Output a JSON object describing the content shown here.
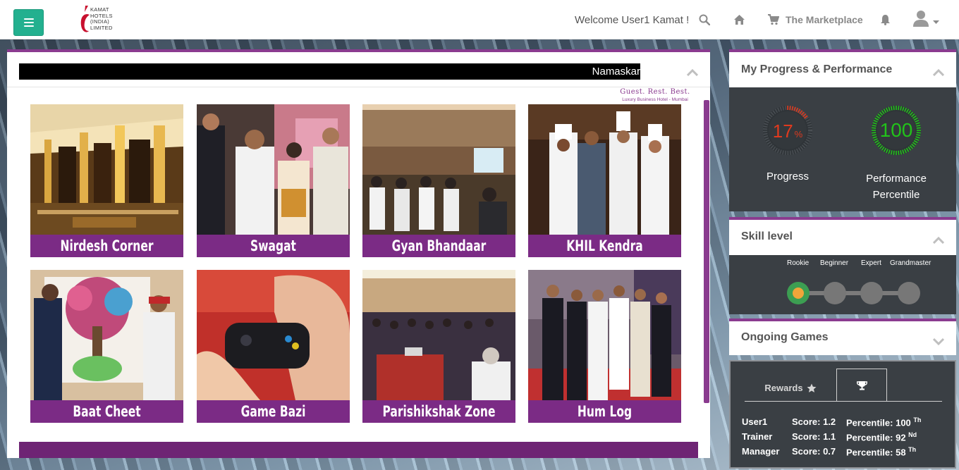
{
  "header": {
    "logo": {
      "line1": "KAMAT",
      "line2": "HOTELS",
      "line3": "(INDIA)",
      "line4": "LIMITED"
    },
    "welcome": "Welcome User1 Kamat !",
    "marketplace_label": "The Marketplace",
    "icons": [
      "menu-icon",
      "search-icon",
      "home-icon",
      "cart-icon",
      "bell-icon",
      "user-icon",
      "caret-down-icon"
    ]
  },
  "main": {
    "marquee": "Namaskar",
    "tagline": "Guest. Rest. Best.",
    "subtagline": "Luxury Business Hotel - Mumbai",
    "tiles": [
      {
        "label": "Nirdesh Corner"
      },
      {
        "label": "Swagat"
      },
      {
        "label": "Gyan Bhandaar"
      },
      {
        "label": "KHIL Kendra"
      },
      {
        "label": "Baat Cheet"
      },
      {
        "label": "Game Bazi"
      },
      {
        "label": "Parishikshak Zone"
      },
      {
        "label": "Hum Log"
      }
    ]
  },
  "progress_card": {
    "title": "My Progress & Performance",
    "progress_value": "17",
    "progress_unit": "%",
    "progress_fraction": 0.17,
    "progress_label": "Progress",
    "performance_value": "100",
    "performance_fraction": 1.0,
    "performance_label_1": "Performance",
    "performance_label_2": "Percentile",
    "colors": {
      "progress": "#e03a1e",
      "performance": "#22c21a"
    }
  },
  "skill_card": {
    "title": "Skill level",
    "levels": [
      "Rookie",
      "Beginner",
      "Expert",
      "Grandmaster"
    ],
    "current_level": "Rookie",
    "colors": {
      "active": "#f0a53a",
      "ring": "#3c9e52",
      "inactive": "#7b7b7b"
    }
  },
  "games_card": {
    "title": "Ongoing Games"
  },
  "rewards_card": {
    "tab_rewards": "Rewards",
    "leaderboard": [
      {
        "name": "User1",
        "score": "Score: 1.2",
        "percentile": "Percentile: 100",
        "suffix": "Th"
      },
      {
        "name": "Trainer",
        "score": "Score: 1.1",
        "percentile": "Percentile: 92",
        "suffix": "Nd"
      },
      {
        "name": "Manager",
        "score": "Score: 0.7",
        "percentile": "Percentile: 58",
        "suffix": "Th"
      }
    ]
  },
  "colors": {
    "brand_purple": "#7b2b85",
    "teal": "#23b08f",
    "dark_panel": "#3a3f44"
  }
}
